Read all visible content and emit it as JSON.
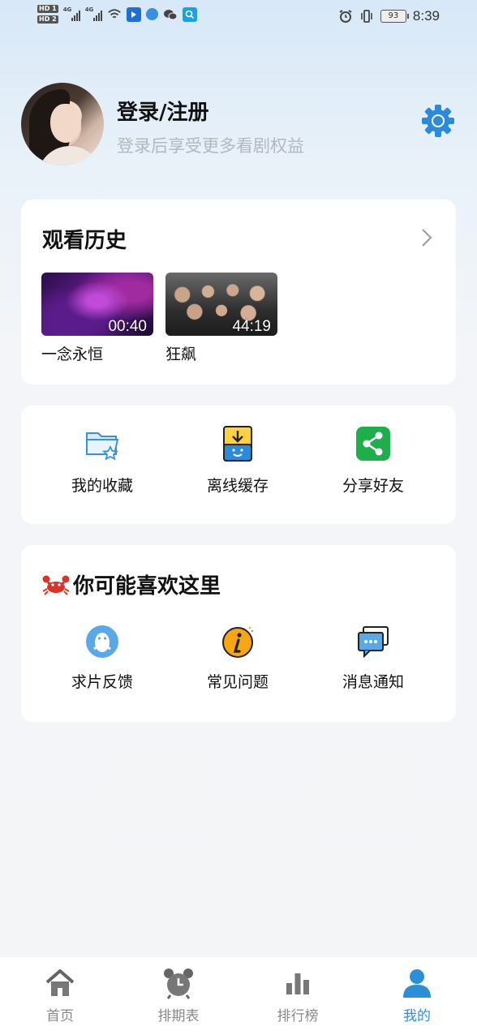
{
  "status_bar": {
    "hd1": "HD 1",
    "hd2": "HD 2",
    "net1": "4G",
    "net2": "4G",
    "battery": "93",
    "time": "8:39"
  },
  "profile": {
    "title": "登录/注册",
    "subtitle": "登录后享受更多看剧权益"
  },
  "history": {
    "title": "观看历史",
    "items": [
      {
        "name": "一念永恒",
        "duration": "00:40"
      },
      {
        "name": "狂飙",
        "duration": "44:19"
      }
    ]
  },
  "tools": [
    {
      "label": "我的收藏",
      "icon": "folder-star-icon"
    },
    {
      "label": "离线缓存",
      "icon": "download-icon"
    },
    {
      "label": "分享好友",
      "icon": "share-icon"
    }
  ],
  "recommend": {
    "emoji": "🦀",
    "title": "你可能喜欢这里",
    "items": [
      {
        "label": "求片反馈",
        "icon": "qq-penguin-icon"
      },
      {
        "label": "常见问题",
        "icon": "info-icon"
      },
      {
        "label": "消息通知",
        "icon": "message-icon"
      }
    ]
  },
  "tabs": [
    {
      "label": "首页",
      "icon": "home-icon"
    },
    {
      "label": "排期表",
      "icon": "alarm-clock-icon"
    },
    {
      "label": "排行榜",
      "icon": "bar-chart-icon"
    },
    {
      "label": "我的",
      "icon": "user-icon",
      "active": true
    }
  ],
  "colors": {
    "accent": "#2c8fd6",
    "bg": "#f4f5f7"
  }
}
